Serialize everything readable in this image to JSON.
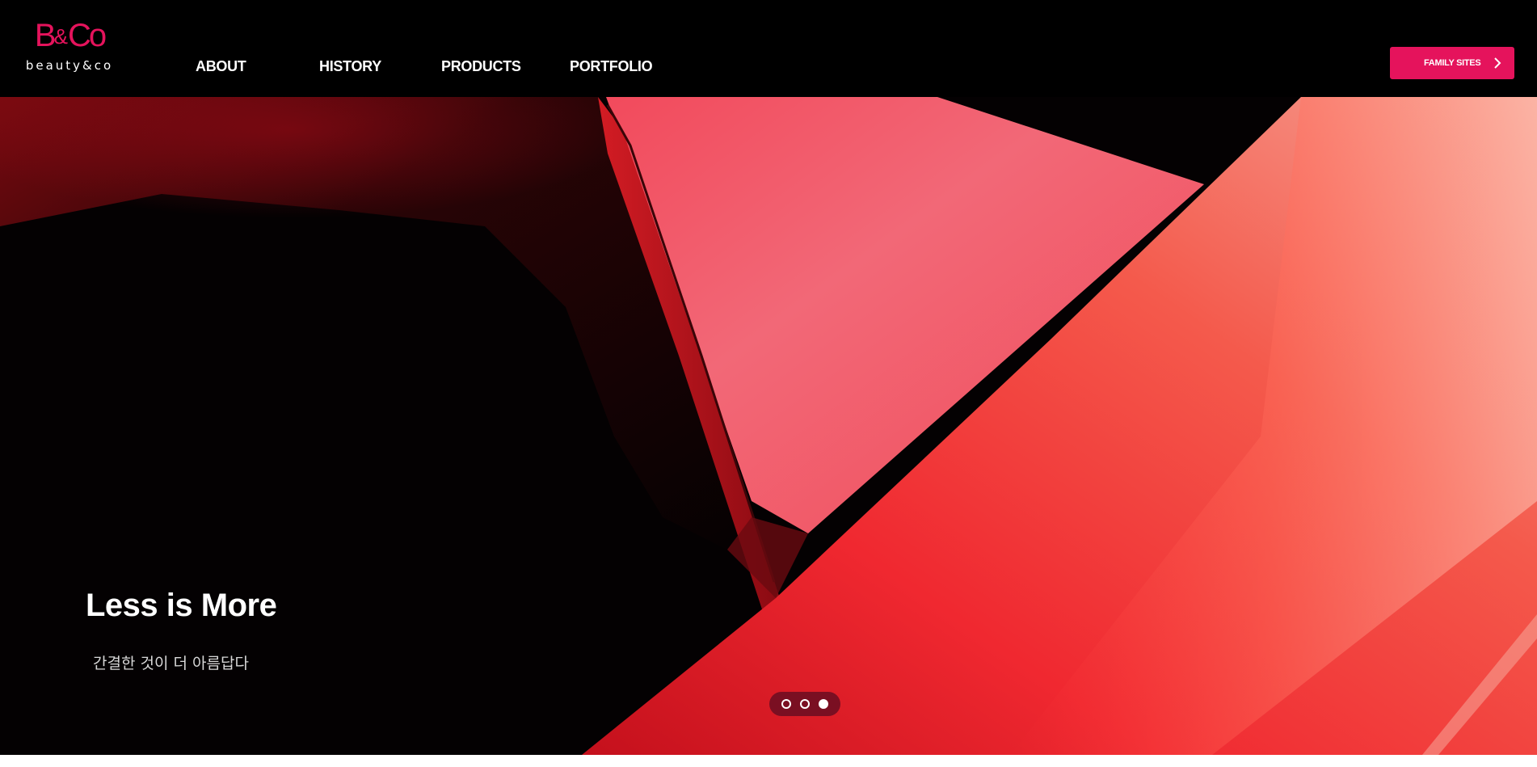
{
  "brand": {
    "logo_mark": "B&Co",
    "logo_sub": "beauty&co",
    "accent_color": "#e5135c"
  },
  "nav": {
    "items": [
      {
        "label": "ABOUT"
      },
      {
        "label": "HISTORY"
      },
      {
        "label": "PRODUCTS"
      },
      {
        "label": "PORTFOLIO"
      }
    ]
  },
  "family_sites": {
    "label": "FAMILY SITES",
    "icon": "chevron-right-icon"
  },
  "hero": {
    "title": "Less is More",
    "subtitle": "간결한 것이 더 아름답다",
    "slide_count": 3,
    "active_slide": 3
  }
}
